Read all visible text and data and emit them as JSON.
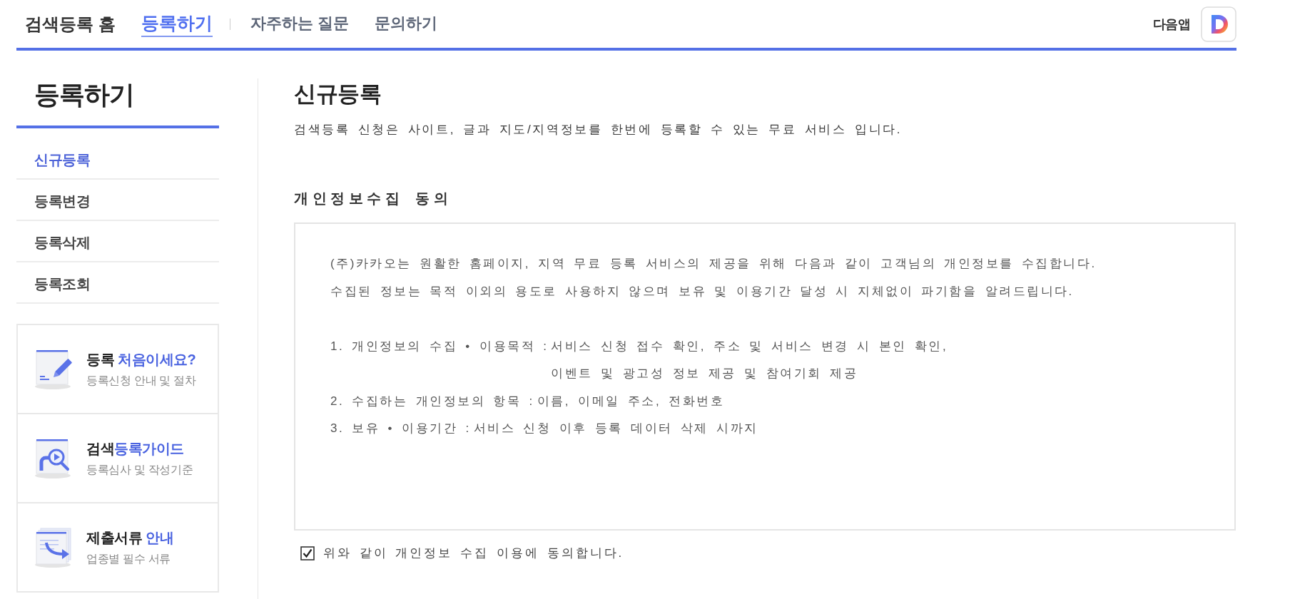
{
  "header": {
    "home": "검색등록 홈",
    "tabs": [
      {
        "label": "등록하기",
        "selected": true
      },
      {
        "label": "자주하는 질문",
        "selected": false
      },
      {
        "label": "문의하기",
        "selected": false
      }
    ],
    "app_link": "다음앱"
  },
  "sidebar": {
    "title": "등록하기",
    "menu": [
      {
        "label": "신규등록",
        "selected": true
      },
      {
        "label": "등록변경",
        "selected": false
      },
      {
        "label": "등록삭제",
        "selected": false
      },
      {
        "label": "등록조회",
        "selected": false
      }
    ],
    "cards": [
      {
        "kind": "apply",
        "title": [
          {
            "text": "등록 ",
            "accent": false
          },
          {
            "text": "처음이세요?",
            "accent": true
          }
        ],
        "subtitle": "등록신청 안내 및 절차"
      },
      {
        "kind": "guide",
        "title": [
          {
            "text": "검색",
            "accent": false
          },
          {
            "text": "등록가이드",
            "accent": true
          }
        ],
        "subtitle": "등록심사 및 작성기준"
      },
      {
        "kind": "documents",
        "title": [
          {
            "text": "제출서류 ",
            "accent": false
          },
          {
            "text": "안내",
            "accent": true
          }
        ],
        "subtitle": "업종별 필수 서류"
      }
    ]
  },
  "main": {
    "title": "신규등록",
    "description": "검색등록 신청은 사이트, 글과 지도/지역정보를 한번에 등록할 수 있는 무료 서비스 입니다.",
    "consent": {
      "heading": "개인정보수집 동의",
      "intro": [
        "(주)카카오는 원활한 홈페이지, 지역 무료 등록 서비스의 제공을 위해 다음과 같이 고객님의 개인정보를 수집합니다.",
        "수집된 정보는 목적 이외의 용도로 사용하지 않으며 보유 및 이용기간 달성 시 지체없이 파기함을 알려드립니다."
      ],
      "items": [
        {
          "label": "1. 개인정보의 수집 • 이용목적 :",
          "lines": [
            "서비스 신청 접수 확인, 주소 및 서비스 변경 시 본인 확인,",
            "이벤트 및 광고성 정보 제공 및 참여기회 제공"
          ]
        },
        {
          "label": "2. 수집하는 개인정보의 항목 :",
          "lines": [
            "이름, 이메일 주소, 전화번호"
          ]
        },
        {
          "label": "3. 보유 • 이용기간 :",
          "lines": [
            "서비스 신청 이후 등록 데이터 삭제 시까지"
          ]
        }
      ]
    },
    "agreement": {
      "label": "위와 같이 개인정보 수집 이용에 동의합니다.",
      "checked": true
    }
  }
}
